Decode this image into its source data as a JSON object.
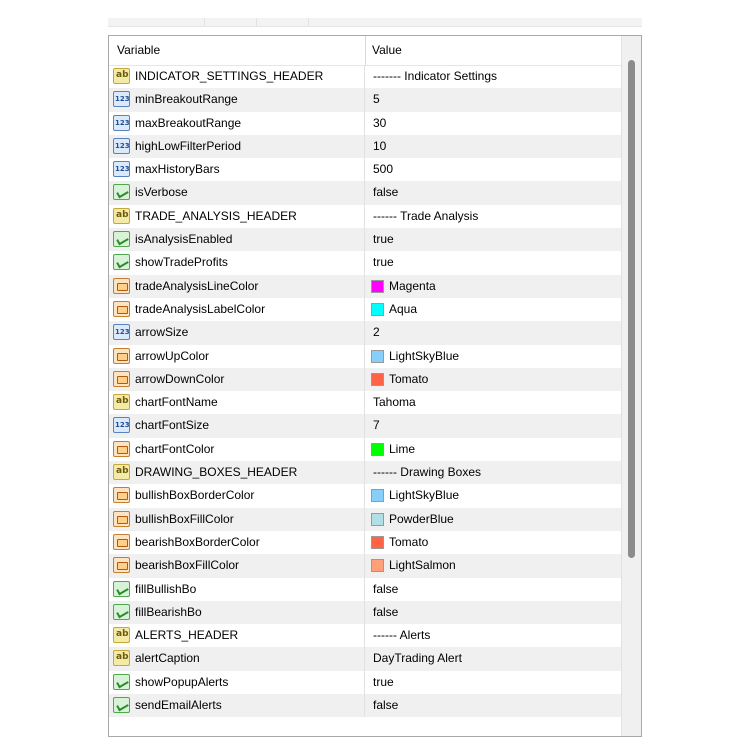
{
  "table": {
    "columns": {
      "variable": "Variable",
      "value": "Value"
    },
    "rows": [
      {
        "type": "ab",
        "name": "INDICATOR_SETTINGS_HEADER",
        "value": "------- Indicator Settings"
      },
      {
        "type": "num",
        "name": "minBreakoutRange",
        "value": "5"
      },
      {
        "type": "num",
        "name": "maxBreakoutRange",
        "value": "30"
      },
      {
        "type": "num",
        "name": "highLowFilterPeriod",
        "value": "10"
      },
      {
        "type": "num",
        "name": "maxHistoryBars",
        "value": "500"
      },
      {
        "type": "bool",
        "name": "isVerbose",
        "value": "false"
      },
      {
        "type": "ab",
        "name": "TRADE_ANALYSIS_HEADER",
        "value": "------ Trade Analysis"
      },
      {
        "type": "bool",
        "name": "isAnalysisEnabled",
        "value": "true"
      },
      {
        "type": "bool",
        "name": "showTradeProfits",
        "value": "true"
      },
      {
        "type": "clr",
        "name": "tradeAnalysisLineColor",
        "value": "Magenta",
        "swatch": "#ff00ff"
      },
      {
        "type": "clr",
        "name": "tradeAnalysisLabelColor",
        "value": "Aqua",
        "swatch": "#00ffff"
      },
      {
        "type": "num",
        "name": "arrowSize",
        "value": "2"
      },
      {
        "type": "clr",
        "name": "arrowUpColor",
        "value": "LightSkyBlue",
        "swatch": "#87cefa"
      },
      {
        "type": "clr",
        "name": "arrowDownColor",
        "value": "Tomato",
        "swatch": "#ff6347"
      },
      {
        "type": "ab",
        "name": "chartFontName",
        "value": "Tahoma"
      },
      {
        "type": "num",
        "name": "chartFontSize",
        "value": "7"
      },
      {
        "type": "clr",
        "name": "chartFontColor",
        "value": "Lime",
        "swatch": "#00ff00"
      },
      {
        "type": "ab",
        "name": "DRAWING_BOXES_HEADER",
        "value": "------ Drawing Boxes"
      },
      {
        "type": "clr",
        "name": "bullishBoxBorderColor",
        "value": "LightSkyBlue",
        "swatch": "#87cefa"
      },
      {
        "type": "clr",
        "name": "bullishBoxFillColor",
        "value": "PowderBlue",
        "swatch": "#b0e0e6"
      },
      {
        "type": "clr",
        "name": "bearishBoxBorderColor",
        "value": "Tomato",
        "swatch": "#ff6347"
      },
      {
        "type": "clr",
        "name": "bearishBoxFillColor",
        "value": "LightSalmon",
        "swatch": "#ffa07a"
      },
      {
        "type": "bool",
        "name": "fillBullishBo",
        "value": "false"
      },
      {
        "type": "bool",
        "name": "fillBearishBo",
        "value": "false"
      },
      {
        "type": "ab",
        "name": "ALERTS_HEADER",
        "value": "------ Alerts"
      },
      {
        "type": "ab",
        "name": "alertCaption",
        "value": "DayTrading Alert"
      },
      {
        "type": "bool",
        "name": "showPopupAlerts",
        "value": "true"
      },
      {
        "type": "bool",
        "name": "sendEmailAlerts",
        "value": "false"
      }
    ]
  },
  "icons": {
    "ab": "string-type-icon",
    "num": "integer-type-icon",
    "bool": "boolean-type-icon",
    "clr": "color-type-icon"
  }
}
